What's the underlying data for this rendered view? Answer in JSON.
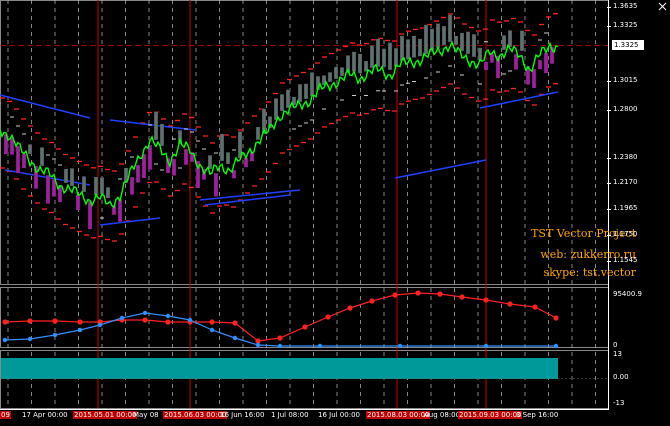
{
  "watermark": {
    "line1": "TST Vector Project",
    "line2": "web: zukkerro.ru",
    "line3": "skype: tst.vector"
  },
  "price_axis": {
    "ticks": [
      "1.3635",
      "1.3325",
      "1.3015",
      "1.2800",
      "1.2380",
      "1.2170",
      "1.1965",
      "1.1750",
      "1.1545"
    ],
    "current_price": "1.3325"
  },
  "oscillator": {
    "max_label": "95400.9",
    "zero_label": "0"
  },
  "histogram": {
    "top_label": "13",
    "zero_label": "0.00",
    "bottom_label": "-13",
    "color": "#009999"
  },
  "time_axis": {
    "labels": [
      {
        "text": "09",
        "highlight": true
      },
      {
        "text": "17 Apr 00:00",
        "highlight": false
      },
      {
        "text": "2015.05.01 00:00",
        "highlight": true
      },
      {
        "text": "May 08",
        "highlight": false
      },
      {
        "text": "2015.06.03 00:00",
        "highlight": true
      },
      {
        "text": "16 Jun 16:00",
        "highlight": false
      },
      {
        "text": "1 Jul 08:00",
        "highlight": false
      },
      {
        "text": "16 Jul 00:00",
        "highlight": false
      },
      {
        "text": "2015.08.03 00:00",
        "highlight": true
      },
      {
        "text": "Aug 08:00",
        "highlight": false
      },
      {
        "text": "2015.09.03 00:00",
        "highlight": true
      },
      {
        "text": "3 Sep 16:00",
        "highlight": false
      }
    ]
  },
  "colors": {
    "background": "#000000",
    "price_line": "#00ff00",
    "band_upper": "#ff2020",
    "band_lower": "#2040ff",
    "candle_up": "#607070",
    "candle_down": "#a020a0",
    "osc_red": "#ff2020",
    "osc_blue": "#3090ff",
    "period_line": "#d00000"
  },
  "icons": {
    "close": "close-icon"
  }
}
